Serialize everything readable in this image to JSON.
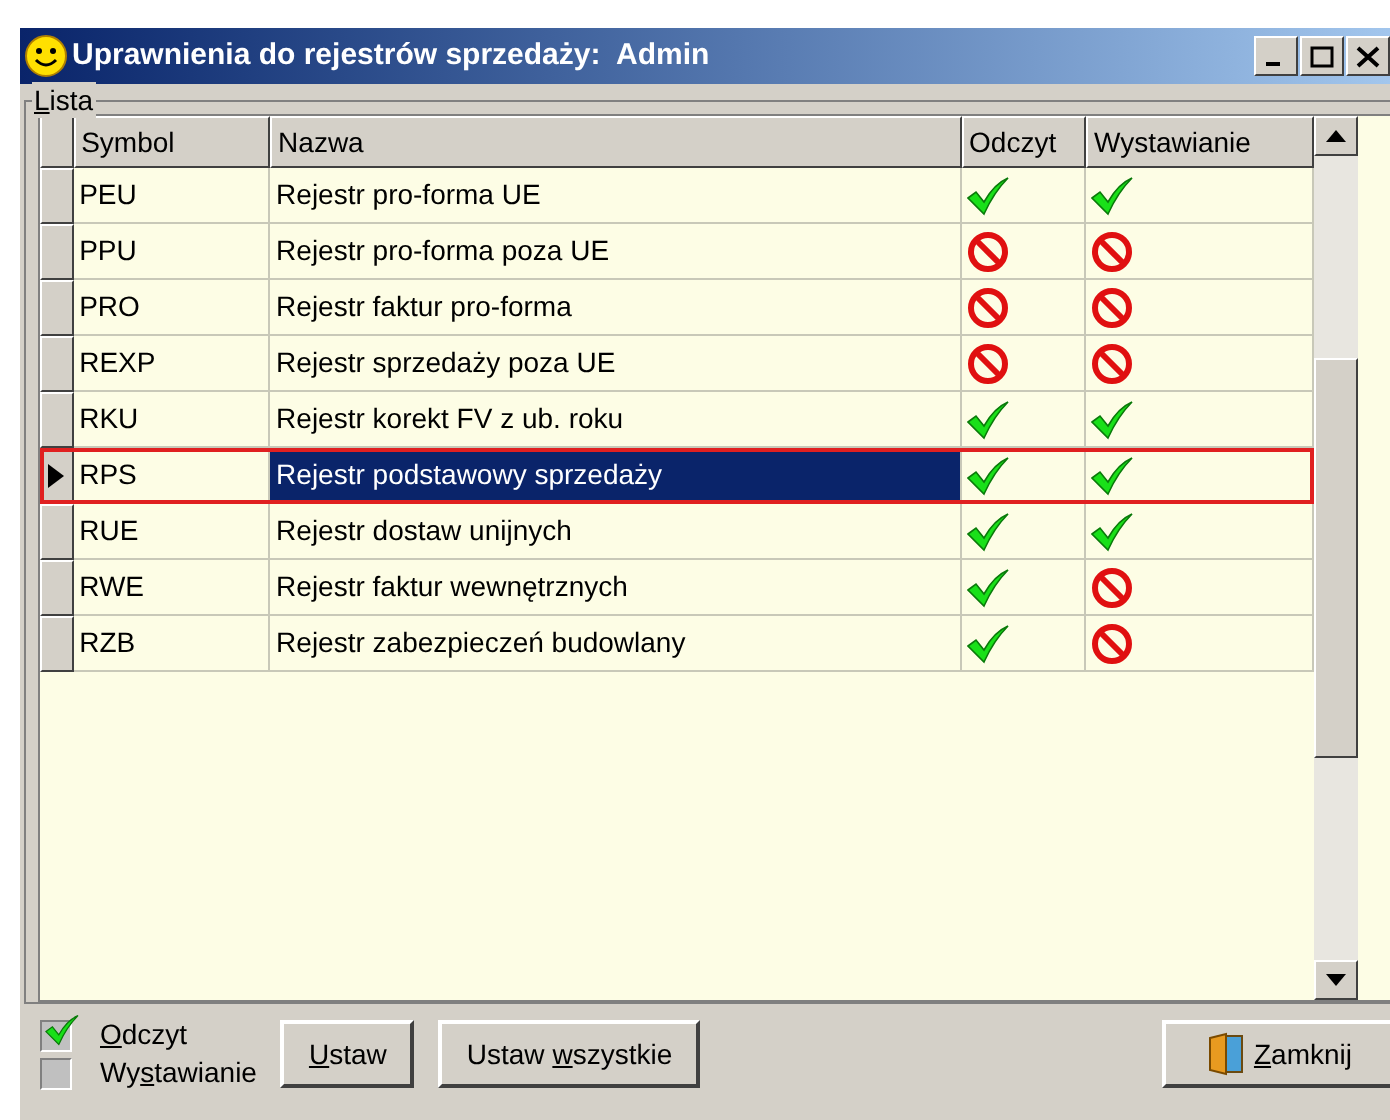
{
  "window": {
    "title": "Uprawnienia do rejestrów sprzedaży:  Admin"
  },
  "group": {
    "hotkey": "L",
    "rest": "ista"
  },
  "table": {
    "columns": [
      "Symbol",
      "Nazwa",
      "Odczyt",
      "Wystawianie"
    ],
    "rows": [
      {
        "symbol": "PEU",
        "name": "Rejestr pro-forma UE",
        "read": true,
        "issue": true,
        "selected": false
      },
      {
        "symbol": "PPU",
        "name": "Rejestr pro-forma poza UE",
        "read": false,
        "issue": false,
        "selected": false
      },
      {
        "symbol": "PRO",
        "name": "Rejestr faktur pro-forma",
        "read": false,
        "issue": false,
        "selected": false
      },
      {
        "symbol": "REXP",
        "name": "Rejestr sprzedaży poza UE",
        "read": false,
        "issue": false,
        "selected": false
      },
      {
        "symbol": "RKU",
        "name": "Rejestr korekt FV z ub. roku",
        "read": true,
        "issue": true,
        "selected": false
      },
      {
        "symbol": "RPS",
        "name": "Rejestr podstawowy sprzedaży",
        "read": true,
        "issue": true,
        "selected": true
      },
      {
        "symbol": "RUE",
        "name": "Rejestr dostaw unijnych",
        "read": true,
        "issue": true,
        "selected": false
      },
      {
        "symbol": "RWE",
        "name": "Rejestr faktur wewnętrznych",
        "read": true,
        "issue": false,
        "selected": false
      },
      {
        "symbol": "RZB",
        "name": "Rejestr zabezpieczeń budowlany",
        "read": true,
        "issue": false,
        "selected": false
      }
    ]
  },
  "checkboxes": [
    {
      "hotkey": "O",
      "after": "dczyt",
      "checked": true
    },
    {
      "before": "Wy",
      "hotkey": "s",
      "after": "tawianie",
      "checked": false
    }
  ],
  "buttons": [
    {
      "hotkey": "U",
      "after": "staw",
      "kind": "text"
    },
    {
      "before": "Ustaw ",
      "hotkey": "w",
      "after": "szystkie",
      "kind": "text"
    },
    {
      "hotkey": "Z",
      "after": "amknij",
      "kind": "door"
    }
  ]
}
